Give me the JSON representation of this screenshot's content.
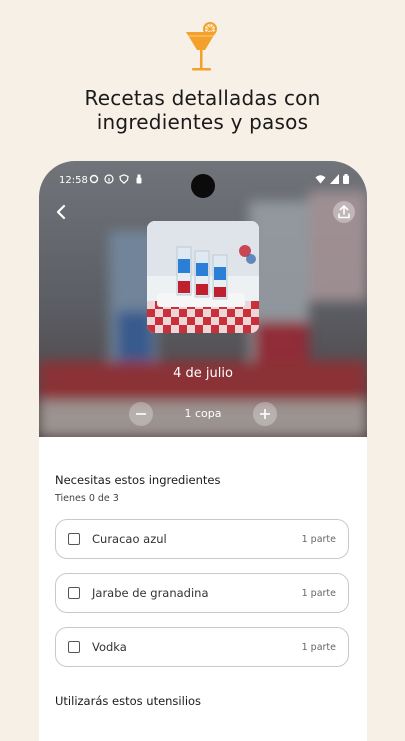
{
  "headline": {
    "line1": "Recetas detalladas con",
    "line2": "ingredientes y pasos"
  },
  "status_bar": {
    "time": "12:58"
  },
  "recipe": {
    "title": "4 de julio",
    "serving": "1 copa"
  },
  "ingredients": {
    "heading": "Necesitas estos ingredientes",
    "progress": "Tienes 0 de 3",
    "items": [
      {
        "name": "Curacao azul",
        "amount": "1 parte"
      },
      {
        "name": "Jarabe de granadina",
        "amount": "1 parte"
      },
      {
        "name": "Vodka",
        "amount": "1 parte"
      }
    ]
  },
  "utensils": {
    "heading": "Utilizarás estos utensilios"
  },
  "colors": {
    "page_bg": "#f7f0e6",
    "accent_orange": "#f4a12b",
    "text_dark": "#1a1a1a"
  }
}
